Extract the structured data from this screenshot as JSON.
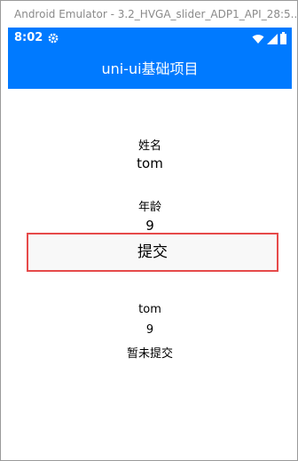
{
  "window": {
    "title": "Android Emulator - 3.2_HVGA_slider_ADP1_API_28:5..."
  },
  "statusbar": {
    "time": "8:02",
    "icons": [
      "gear-icon",
      "wifi-icon",
      "signal-icon",
      "battery-icon"
    ]
  },
  "navbar": {
    "title": "uni-ui基础项目"
  },
  "form": {
    "name_label": "姓名",
    "name_value": "tom",
    "age_label": "年龄",
    "age_value": "9",
    "submit_label": "提交"
  },
  "result": {
    "name": "tom",
    "age": "9",
    "status": "暂未提交"
  },
  "colors": {
    "primary": "#007aff",
    "highlight_border": "#e64a4a"
  }
}
